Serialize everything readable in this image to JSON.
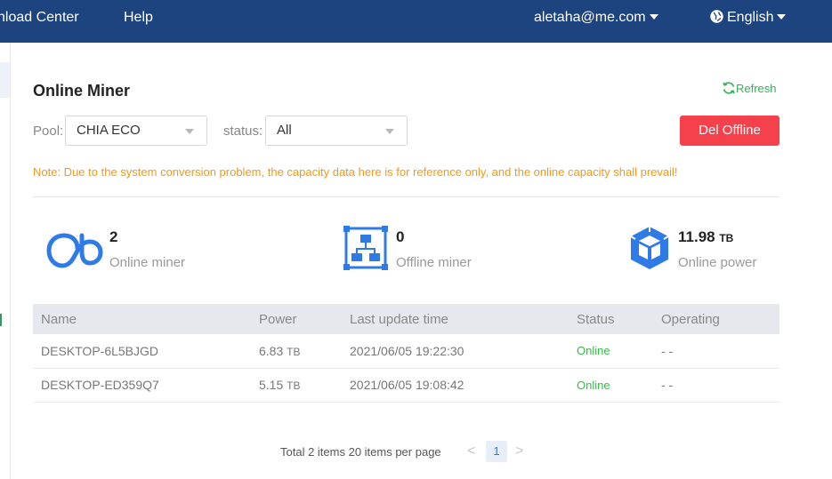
{
  "nav": {
    "download_center": "nload Center",
    "help": "Help",
    "account": "aletaha@me.com",
    "language": "English"
  },
  "card": {
    "title": "Online Miner",
    "refresh_label": "Refresh"
  },
  "filters": {
    "pool_label": "Pool:",
    "pool_value": "CHIA ECO",
    "status_label": "status:",
    "status_value": "All",
    "del_offline_label": "Del Offline"
  },
  "note": "Note: Due to the system conversion problem, the capacity data here is for reference only, and the online capacity shall prevail!",
  "stats": {
    "online_miner": {
      "value": "2",
      "label": "Online miner"
    },
    "offline_miner": {
      "value": "0",
      "label": "Offline miner"
    },
    "online_power": {
      "value": "11.98",
      "unit": "TB",
      "label": "Online power"
    }
  },
  "table": {
    "headers": {
      "name": "Name",
      "power": "Power",
      "last_update": "Last update time",
      "status": "Status",
      "operating": "Operating"
    },
    "rows": [
      {
        "name": "DESKTOP-6L5BJGD",
        "power": "6.83",
        "unit": "TB",
        "last_update": "2021/06/05 19:22:30",
        "status": "Online",
        "operating": "- -"
      },
      {
        "name": "DESKTOP-ED359Q7",
        "power": "5.15",
        "unit": "TB",
        "last_update": "2021/06/05 19:08:42",
        "status": "Online",
        "operating": "- -"
      }
    ]
  },
  "pagination": {
    "summary": "Total 2 items 20 items per page",
    "current_page": "1",
    "prev": "<",
    "next": ">"
  },
  "colors": {
    "nav_bg": "#1e4480",
    "accent_blue": "#2f7be5",
    "danger": "#f5414b",
    "warning_text": "#ef9a1c",
    "online_green": "#2fbf44",
    "refresh_green": "#36b05a"
  }
}
